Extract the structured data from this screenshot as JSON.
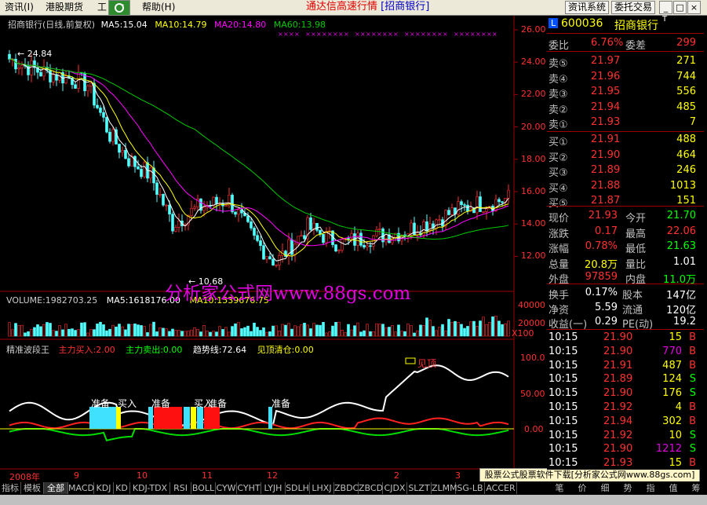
{
  "menu": {
    "items": [
      "资讯(I)",
      "港股期货",
      "工",
      "帮助(H)"
    ],
    "title_prefix": "通达信高速行情",
    "title_stock": "[招商银行]",
    "info_btn": "资讯系统",
    "trade_btn": "委托交易",
    "win_buttons": [
      "_",
      "□",
      "×"
    ]
  },
  "kline": {
    "header": "招商银行(日线,前复权)",
    "ma5": "MA5:15.04",
    "ma10": "MA10:14.79",
    "ma20": "MA20:14.80",
    "ma60": "MA60:13.98",
    "high_label": "24.84",
    "low_label": "10.68",
    "price_ticks": [
      "26.00",
      "24.00",
      "22.00",
      "20.00",
      "18.00",
      "16.00",
      "14.00",
      "12.00"
    ],
    "colors": {
      "up": "#ff3030",
      "down": "#54ffff",
      "ma5": "#ffffff",
      "ma10": "#ffff00",
      "ma20": "#ff00ff",
      "ma60": "#00cc00"
    }
  },
  "volume": {
    "header": "VOLUME:1982703.25",
    "ma5": "MA5:1618176.00",
    "ma10": "MA10:1539676.75",
    "ticks": [
      "40000",
      "20000"
    ],
    "unit": "X100"
  },
  "indicator": {
    "name": "精准波段王",
    "buy": "主力买入:2.00",
    "sell": "主力卖出:0.00",
    "trend": "趋势线:72.64",
    "top": "见顶清仓:0.00",
    "ticks": [
      "100.0",
      "50.00",
      "0.00"
    ],
    "signals": [
      "准备",
      "买入",
      "准备",
      "买入",
      "准备",
      "准备"
    ],
    "top_label": "见顶"
  },
  "time_axis": [
    "2008年",
    "9",
    "10",
    "11",
    "12",
    "2",
    "3"
  ],
  "watermark": "分析家公式网www.88gs.com",
  "banner": "股票公式股票软件下载[分析家公式网www.88gs.com]",
  "panel": {
    "code": "600036",
    "name": "招商银行",
    "badge": "L",
    "superscript": "T",
    "weibi_label": "委比",
    "weibi_value": "6.76%",
    "weicha_label": "委差",
    "weicha_value": "299",
    "asks": [
      {
        "label": "卖⑤",
        "price": "21.97",
        "vol": "271"
      },
      {
        "label": "卖④",
        "price": "21.96",
        "vol": "744"
      },
      {
        "label": "卖③",
        "price": "21.95",
        "vol": "556"
      },
      {
        "label": "卖②",
        "price": "21.94",
        "vol": "485"
      },
      {
        "label": "卖①",
        "price": "21.93",
        "vol": "7"
      }
    ],
    "bids": [
      {
        "label": "买①",
        "price": "21.91",
        "vol": "488"
      },
      {
        "label": "买②",
        "price": "21.90",
        "vol": "464"
      },
      {
        "label": "买③",
        "price": "21.89",
        "vol": "246"
      },
      {
        "label": "买④",
        "price": "21.88",
        "vol": "1013"
      },
      {
        "label": "买⑤",
        "price": "21.87",
        "vol": "151"
      }
    ],
    "stats": [
      {
        "l1": "现价",
        "v1": "21.93",
        "c1": "#ff3030",
        "l2": "今开",
        "v2": "21.70",
        "c2": "#00ff00"
      },
      {
        "l1": "涨跌",
        "v1": "0.17",
        "c1": "#ff3030",
        "l2": "最高",
        "v2": "22.06",
        "c2": "#ff3030"
      },
      {
        "l1": "涨幅",
        "v1": "0.78%",
        "c1": "#ff3030",
        "l2": "最低",
        "v2": "21.63",
        "c2": "#00ff00"
      },
      {
        "l1": "总量",
        "v1": "20.8万",
        "c1": "#ffff00",
        "l2": "量比",
        "v2": "1.01",
        "c2": "#ffffff"
      },
      {
        "l1": "外盘",
        "v1": "97859",
        "c1": "#ff3030",
        "l2": "内盘",
        "v2": "11.0万",
        "c2": "#00ff00"
      }
    ],
    "fund": [
      {
        "l1": "换手",
        "v1": "0.17%",
        "l2": "股本",
        "v2": "147亿"
      },
      {
        "l1": "净资",
        "v1": "5.59",
        "l2": "流通",
        "v2": "120亿"
      },
      {
        "l1": "收益(一)",
        "v1": "0.29",
        "l2": "PE(动)",
        "v2": "19.2"
      }
    ],
    "ticks": [
      {
        "time": "10:15",
        "price": "21.90",
        "pc": "#ff3030",
        "vol": "15",
        "vc": "#ffff00",
        "side": "B",
        "sc": "#ff3030"
      },
      {
        "time": "10:15",
        "price": "21.90",
        "pc": "#ff3030",
        "vol": "770",
        "vc": "#e000e0",
        "side": "B",
        "sc": "#ff3030"
      },
      {
        "time": "10:15",
        "price": "21.91",
        "pc": "#ff3030",
        "vol": "487",
        "vc": "#ffff00",
        "side": "B",
        "sc": "#ff3030"
      },
      {
        "time": "10:15",
        "price": "21.89",
        "pc": "#ff3030",
        "vol": "124",
        "vc": "#ffff00",
        "side": "S",
        "sc": "#00ff00"
      },
      {
        "time": "10:15",
        "price": "21.90",
        "pc": "#ff3030",
        "vol": "176",
        "vc": "#ffff00",
        "side": "S",
        "sc": "#00ff00"
      },
      {
        "time": "10:15",
        "price": "21.92",
        "pc": "#ff3030",
        "vol": "4",
        "vc": "#ffff00",
        "side": "B",
        "sc": "#ff3030"
      },
      {
        "time": "10:15",
        "price": "21.94",
        "pc": "#ff3030",
        "vol": "302",
        "vc": "#ffff00",
        "side": "B",
        "sc": "#ff3030"
      },
      {
        "time": "10:15",
        "price": "21.92",
        "pc": "#ff3030",
        "vol": "10",
        "vc": "#ffff00",
        "side": "S",
        "sc": "#00ff00"
      },
      {
        "time": "10:15",
        "price": "21.90",
        "pc": "#ff3030",
        "vol": "1212",
        "vc": "#e000e0",
        "side": "S",
        "sc": "#00ff00"
      },
      {
        "time": "10:15",
        "price": "21.93",
        "pc": "#ff3030",
        "vol": "15",
        "vc": "#ffff00",
        "side": "B",
        "sc": "#ff3030"
      }
    ]
  },
  "tabs": [
    "指标",
    "模板",
    "全部",
    "MACD",
    "KDJ",
    "KD",
    "KDJ-TDX",
    "RSI",
    "BOLL",
    "CYW",
    "CYHT",
    "LYJH",
    "SDLH",
    "LHXJ",
    "ZBDC",
    "ZBCD",
    "CJDX",
    "SLZT",
    "ZLMM",
    "SG-LB",
    "ACCER"
  ],
  "right_tabs": [
    "笔",
    "价",
    "细",
    "势",
    "指",
    "值",
    "筹"
  ]
}
